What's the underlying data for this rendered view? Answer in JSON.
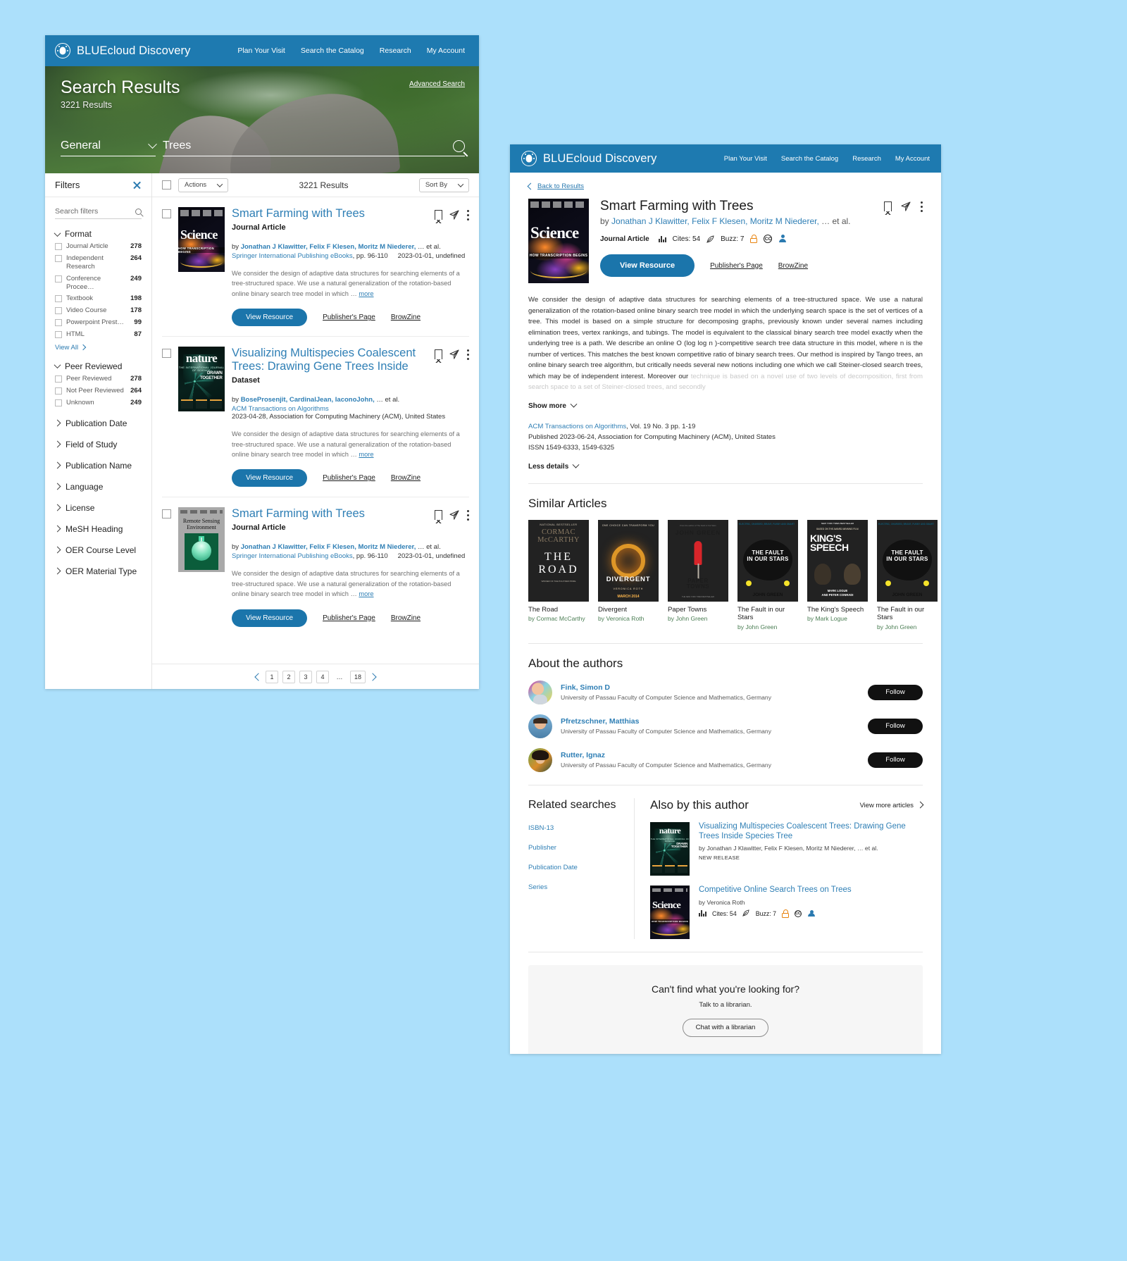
{
  "brand": {
    "name": "BLUEcloud Discovery",
    "logo_icon": "globe-person-icon"
  },
  "topnav": [
    {
      "label": "Plan Your Visit"
    },
    {
      "label": "Search the Catalog"
    },
    {
      "label": "Research"
    },
    {
      "label": "My Account"
    }
  ],
  "search_page": {
    "hero": {
      "title": "Search Results",
      "results_count": "3221 Results",
      "advanced_search": "Advanced Search",
      "scope_selected": "General",
      "scope_chevron_icon": "chevron-down-icon",
      "query": "Trees",
      "search_icon": "search-icon"
    },
    "filters": {
      "title": "Filters",
      "close_icon": "close-icon",
      "search_placeholder": "Search filters",
      "search_icon": "search-icon",
      "groups": [
        {
          "name": "Format",
          "expanded": true,
          "options": [
            {
              "label": "Journal Article",
              "count": "278"
            },
            {
              "label": "Independent Research",
              "count": "264"
            },
            {
              "label": "Conference Procee…",
              "count": "249"
            },
            {
              "label": "Textbook",
              "count": "198"
            },
            {
              "label": "Video Course",
              "count": "178"
            },
            {
              "label": "Powerpoint Prest…",
              "count": "99"
            },
            {
              "label": "HTML",
              "count": "87"
            }
          ],
          "view_all": "View All"
        },
        {
          "name": "Peer Reviewed",
          "expanded": true,
          "options": [
            {
              "label": "Peer Reviewed",
              "count": "278"
            },
            {
              "label": "Not Peer Reviewed",
              "count": "264"
            },
            {
              "label": "Unknown",
              "count": "249"
            }
          ]
        }
      ],
      "collapsed_groups": [
        "Publication Date",
        "Field of Study",
        "Publication Name",
        "Language",
        "License",
        "MeSH Heading",
        "OER Course Level",
        "OER Material Type"
      ]
    },
    "toolbar": {
      "actions_label": "Actions",
      "results_count": "3221 Results",
      "sort_by_label": "Sort By"
    },
    "results": [
      {
        "cover": "science",
        "title": "Smart Farming with Trees",
        "type": "Journal Article",
        "by_prefix": "by",
        "authors": "Jonathan J Klawitter, Felix F Klesen, Moritz M Niederer,",
        "etal": "… et al.",
        "source": "Springer International Publishing eBooks",
        "pages": ", pp. 96-110",
        "date": "2023-01-01, undefined",
        "description": "We consider the design of adaptive data structures for searching elements of a tree-structured space. We use a natural generalization of the rotation-based online binary search tree model in which …",
        "more_label": "more",
        "actions": {
          "primary": "View Resource",
          "publisher": "Publisher's Page",
          "browzine": "BrowZine"
        }
      },
      {
        "cover": "nature",
        "title": "Visualizing Multispecies Coalescent Trees: Drawing Gene Trees Inside",
        "type": "Dataset",
        "by_prefix": "by",
        "authors": "BoseProsenjit, CardinalJean, IaconoJohn,",
        "etal": "… et al.",
        "source": "ACM Transactions on Algorithms",
        "pages": "",
        "date": "2023-04-28, Association for Computing Machinery (ACM), United States",
        "description": "We consider the design of adaptive data structures for searching elements of a tree-structured space. We use a natural generalization of the rotation-based online binary search tree model in which …",
        "more_label": "more",
        "actions": {
          "primary": "View Resource",
          "publisher": "Publisher's Page",
          "browzine": "BrowZine"
        }
      },
      {
        "cover": "rse",
        "title": "Smart Farming with Trees",
        "type": "Journal Article",
        "by_prefix": "by",
        "authors": "Jonathan J Klawitter, Felix F Klesen, Moritz M Niederer,",
        "etal": "… et al.",
        "source": "Springer International Publishing eBooks",
        "pages": ", pp. 96-110",
        "date": "2023-01-01, undefined",
        "description": "We consider the design of adaptive data structures for searching elements of a tree-structured space. We use a natural generalization of the rotation-based online binary search tree model in which …",
        "more_label": "more",
        "actions": {
          "primary": "View Resource",
          "publisher": "Publisher's Page",
          "browzine": "BrowZine"
        }
      }
    ],
    "pagination": {
      "prev_icon": "chevron-left-icon",
      "next_icon": "chevron-right-icon",
      "pages": [
        "1",
        "2",
        "3",
        "4",
        "…",
        "18"
      ],
      "current": "1"
    },
    "covers": {
      "science_wordmark": "Science",
      "science_band": "HOW TRANSCRIPTION BEGINS",
      "nature_wordmark": "nature",
      "nature_sub": "THE INTERNATIONAL JOURNAL OF SCIENCE",
      "nature_drawn": "DRAWN\nTOGETHER",
      "rse_title": "Remote Sensing\nEnvironment"
    }
  },
  "detail_page": {
    "back_label": "Back to Results",
    "back_icon": "arrow-left-icon",
    "title": "Smart Farming with Trees",
    "by_prefix": "by",
    "authors": "Jonathan J Klawitter, Felix F Klesen, Moritz M Niederer,",
    "etal": "… et al.",
    "type": "Journal Article",
    "cites_label": "Cites: 54",
    "cites_icon": "bar-chart-icon",
    "buzz_label": "Buzz: 7",
    "buzz_icon": "quill-icon",
    "open_access_icon": "open-lock-icon",
    "creative_commons_icon": "creative-commons-icon",
    "author-profile_icon": "person-icon",
    "bookmark_icon": "bookmark-icon",
    "share_icon": "send-icon",
    "more_icon": "kebab-menu-icon",
    "actions": {
      "primary": "View Resource",
      "publisher": "Publisher's Page",
      "browzine": "BrowZine"
    },
    "abstract": "We consider the design of adaptive data structures for searching elements of a tree-structured space. We use a natural generalization of the rotation-based online binary search tree model in which the underlying search space is the set of vertices of a tree. This model is based on a simple structure for decomposing graphs, previously known under several names including elimination trees, vertex rankings, and tubings. The model is equivalent to the classical binary search tree model exactly when the underlying tree is a path. We describe an online O (log log n )-competitive search tree data structure in this model, where n is the number of vertices. This matches the best known competitive ratio of binary search trees. Our method is inspired by Tango trees, an online binary search tree algorithm, but critically needs several new notions including one which we call Steiner-closed search trees, which may be of independent interest. Moreover our",
    "abstract_fade": "technique is based on a novel use of two levels of decomposition, first from search space to a set of Steiner-closed trees, and secondly",
    "show_more": "Show more",
    "show_more_icon": "chevron-down-icon",
    "publication": {
      "journal": "ACM Transactions on Algorithms",
      "vol": ", Vol. 19 No. 3 pp. 1-19",
      "published": "Published 2023-06-24, Association for Computing Machinery (ACM), United States",
      "issn": "ISSN 1549-6333, 1549-6325"
    },
    "less_details": "Less details",
    "less_details_icon": "chevron-down-icon",
    "similar": {
      "heading": "Similar Articles",
      "items": [
        {
          "cover": "road",
          "title": "The Road",
          "author": "by Cormac McCarthy"
        },
        {
          "cover": "divergent",
          "title": "Divergent",
          "author": "by Veronica Roth"
        },
        {
          "cover": "papertowns",
          "title": "Paper Towns",
          "author": "by John Green"
        },
        {
          "cover": "fault",
          "title": "The Fault in our Stars",
          "author": "by John Green"
        },
        {
          "cover": "kings",
          "title": "The King's Speech",
          "author": "by Mark Logue"
        },
        {
          "cover": "fault",
          "title": "The Fault in our Stars",
          "author": "by John Green"
        }
      ]
    },
    "similar_covers": {
      "road_pre": "NATIONAL BESTSELLER",
      "road_author": "CORMAC\nMcCARTHY",
      "road_the": "THE",
      "road_road": "ROAD",
      "divergent_tag": "ONE CHOICE CAN TRANSFORM YOU",
      "divergent_title": "DIVERGENT",
      "divergent_sub": "VERONICA ROTH",
      "divergent_date": "MARCH 2014",
      "pt_pre": "From the author of The Fault in Our Stars",
      "pt_author": "JOHN GREEN",
      "pt_title": "PAPER TOWNS",
      "pt_sub": "THE NEW YORK TIMES BESTSELLER",
      "fault_tag": "ELECTRIC, CHARGED, BRAVE, FUNNY AND SMART",
      "fault_title": "THE FAULT IN OUR STARS",
      "fault_author": "JOHN GREEN",
      "kings_pre": "NEW YORK TIMES BESTSELLER",
      "kings_sub": "BASED ON THE AWARD-WINNING FILM",
      "kings_title": "THE KING'S SPEECH",
      "kings_names": "MARK LOGUE\nAND PETER CONRADI"
    },
    "authors_section": {
      "heading": "About the authors",
      "follow_label": "Follow",
      "people": [
        {
          "name": "Fink, Simon D",
          "affiliation": "University of Passau Faculty of Computer Science and Mathematics, Germany"
        },
        {
          "name": "Pfretzschner, Matthias",
          "affiliation": "University of Passau Faculty of Computer Science and Mathematics, Germany"
        },
        {
          "name": "Rutter, Ignaz",
          "affiliation": "University of Passau Faculty of Computer Science and Mathematics, Germany"
        }
      ]
    },
    "related_searches": {
      "heading": "Related searches",
      "items": [
        "ISBN-13",
        "Publisher",
        "Publication Date",
        "Series"
      ]
    },
    "also_by": {
      "heading": "Also by this author",
      "view_more": "View more articles",
      "view_more_icon": "chevron-right-icon",
      "items": [
        {
          "cover": "nature",
          "title": "Visualizing Multispecies Coalescent Trees: Drawing Gene Trees Inside Species Tree",
          "by": "by Jonathan J Klawitter, Felix F Klesen, Moritz M Niederer, … et al.",
          "tag": "NEW RELEASE",
          "stats": null
        },
        {
          "cover": "science",
          "title": "Competitive Online Search Trees on Trees",
          "by": "by Veronica Roth",
          "tag": null,
          "stats": {
            "cites": "Cites: 54",
            "buzz": "Buzz: 7"
          }
        }
      ]
    },
    "help": {
      "heading": "Can't find what you're looking for?",
      "subtext": "Talk to a librarian.",
      "button": "Chat with a librarian"
    }
  },
  "colors": {
    "brand_blue": "#1e7ab0",
    "link_blue": "#2f7fb5",
    "page_bg": "#ACE0FB",
    "accent_orange": "#e8820c"
  }
}
